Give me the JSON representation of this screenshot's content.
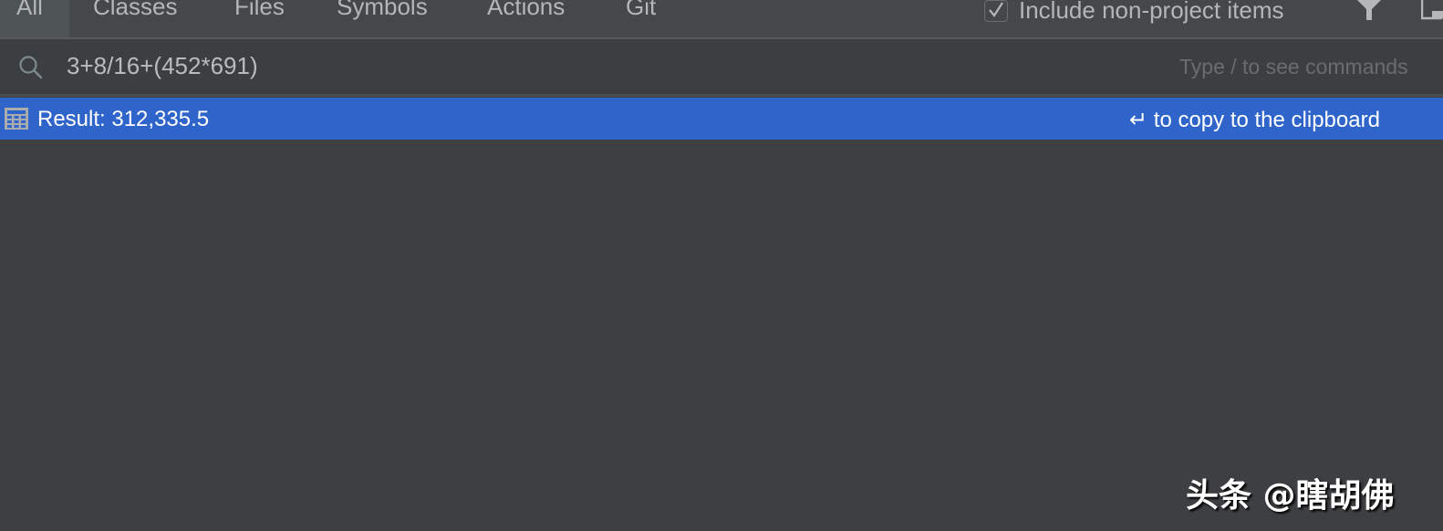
{
  "tabs": [
    {
      "label": "All",
      "selected": true
    },
    {
      "label": "Classes",
      "selected": false
    },
    {
      "label": "Files",
      "selected": false
    },
    {
      "label": "Symbols",
      "selected": false
    },
    {
      "label": "Actions",
      "selected": false
    },
    {
      "label": "Git",
      "selected": false
    }
  ],
  "toolbar": {
    "include_non_project": {
      "label": "Include non-project items",
      "checked": true
    },
    "filter_icon": "filter-icon",
    "layout_icon": "preview-icon"
  },
  "search": {
    "value": "3+8/16+(452*691)",
    "hint": "Type / to see commands",
    "icon": "search-icon"
  },
  "result": {
    "icon": "calculator-icon",
    "text": "Result: 312,335.5",
    "hint": "↵ to copy to the clipboard"
  },
  "watermark": "头条 @瞎胡佛",
  "colors": {
    "selection": "#2f65ca",
    "background": "#3c3f41",
    "tabbar": "#45484a"
  }
}
